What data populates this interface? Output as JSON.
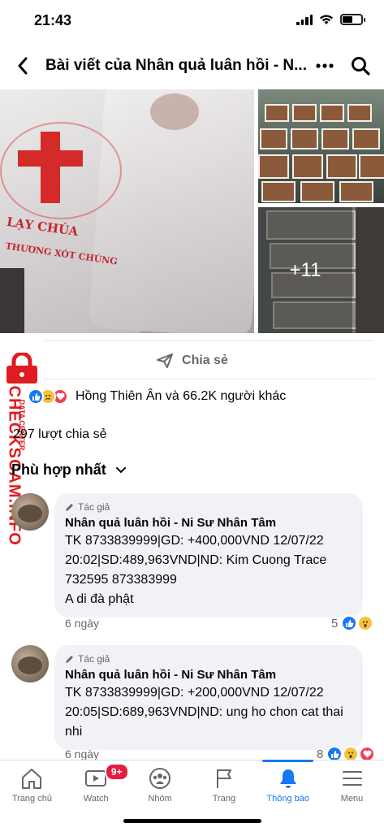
{
  "status": {
    "time": "21:43"
  },
  "header": {
    "title": "Bài viết của Nhân quả luân hồi - N..."
  },
  "photos": {
    "bag_text_1": "LẠY CHÚA",
    "bag_text_2": "THƯƠNG XÓT CHÚNG",
    "more_count": "+11"
  },
  "actions": {
    "share_label": "Chia sẻ"
  },
  "reactions": {
    "summary": "Hồng Thiên Ân và 66.2K người khác"
  },
  "shares": {
    "text": "297 lượt chia sẻ"
  },
  "watermark": {
    "main": "CHECKSCAM.INFO",
    "sub": "DATA CENTER"
  },
  "sort": {
    "label": "Phù hợp nhất"
  },
  "comments": [
    {
      "badge": "Tác giả",
      "author": "Nhân quả luân hồi - Ni Sư Nhân Tâm",
      "body": "TK 8733839999|GD: +400,000VND 12/07/22 20:02|SD:489,963VND|ND: Kim Cuong Trace 732595 873383999\nA di đà phật",
      "time": "6 ngày",
      "reaction_count": "5"
    },
    {
      "badge": "Tác giả",
      "author": "Nhân quả luân hồi - Ni Sư Nhân Tâm",
      "body": "TK 8733839999|GD: +200,000VND 12/07/22 20:05|SD:689,963VND|ND: ung ho chon cat thai nhi",
      "time": "6 ngày",
      "reaction_count": "8"
    }
  ],
  "tabbar": {
    "items": [
      {
        "label": "Trang chủ",
        "icon": "home-icon"
      },
      {
        "label": "Watch",
        "icon": "watch-icon",
        "badge": "9+"
      },
      {
        "label": "Nhóm",
        "icon": "groups-icon"
      },
      {
        "label": "Trang",
        "icon": "flag-icon"
      },
      {
        "label": "Thông báo",
        "icon": "bell-icon",
        "active": true
      },
      {
        "label": "Menu",
        "icon": "menu-icon"
      }
    ]
  },
  "colors": {
    "accent": "#1877f2",
    "badge": "#e41e3f",
    "watermark": "#e11b22",
    "text_secondary": "#65676b"
  }
}
